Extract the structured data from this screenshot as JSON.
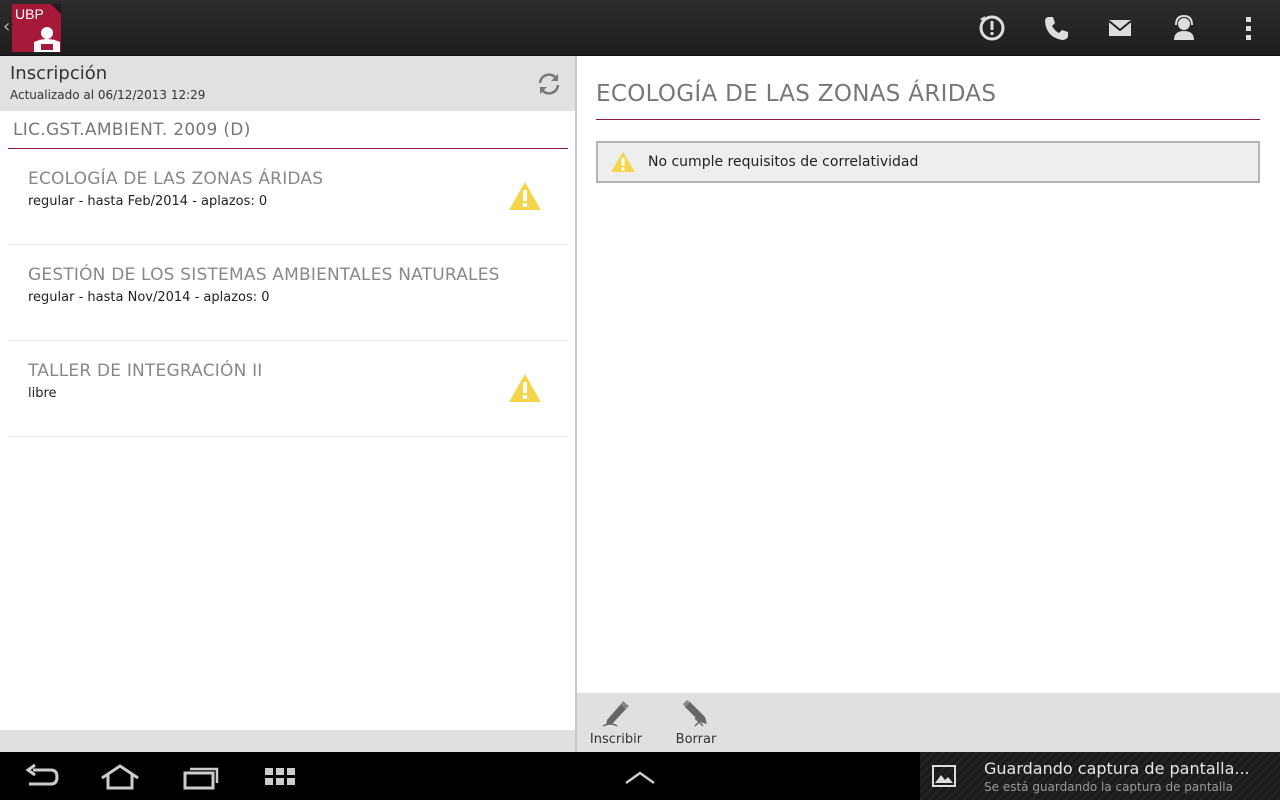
{
  "app": {
    "logo_text": "UBP",
    "accent_color": "#a6193a",
    "toolbar_icons": [
      "alert-clock-icon",
      "phone-icon",
      "mail-icon",
      "contact-person-icon",
      "overflow-menu-icon"
    ]
  },
  "left_panel": {
    "title": "Inscripción",
    "subtitle": "Actualizado al 06/12/2013 12:29",
    "career": "LIC.GST.AMBIENT. 2009 (D)",
    "courses": [
      {
        "name": "ECOLOGÍA DE LAS ZONAS ÁRIDAS",
        "status": "regular - hasta Feb/2014 - aplazos: 0",
        "warning": true
      },
      {
        "name": "GESTIÓN DE LOS SISTEMAS AMBIENTALES NATURALES",
        "status": "regular - hasta Nov/2014 - aplazos: 0",
        "warning": false
      },
      {
        "name": "TALLER DE INTEGRACIÓN II",
        "status": "libre",
        "warning": true
      }
    ]
  },
  "detail": {
    "title": "ECOLOGÍA DE LAS ZONAS ÁRIDAS",
    "warning": "No cumple requisitos de correlatividad"
  },
  "bottom_actions": {
    "enroll_label": "Inscribir",
    "delete_label": "Borrar"
  },
  "notification": {
    "title": "Guardando captura de pantalla...",
    "subtitle": "Se está guardando la captura de pantalla"
  }
}
